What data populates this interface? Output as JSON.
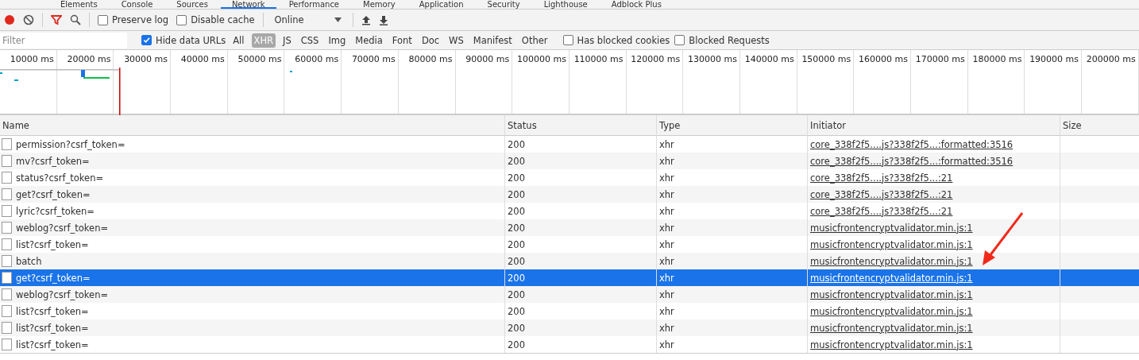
{
  "panel_tabs": [
    {
      "label": "Elements",
      "selected": false
    },
    {
      "label": "Console",
      "selected": false
    },
    {
      "label": "Sources",
      "selected": false
    },
    {
      "label": "Network",
      "selected": true
    },
    {
      "label": "Performance",
      "selected": false
    },
    {
      "label": "Memory",
      "selected": false
    },
    {
      "label": "Application",
      "selected": false
    },
    {
      "label": "Security",
      "selected": false
    },
    {
      "label": "Lighthouse",
      "selected": false
    },
    {
      "label": "Adblock Plus",
      "selected": false
    }
  ],
  "toolbar": {
    "recording": true,
    "filter_active": true,
    "preserve_log": {
      "label": "Preserve log",
      "checked": false
    },
    "disable_cache": {
      "label": "Disable cache",
      "checked": false
    },
    "throttling": "Online"
  },
  "filter_bar": {
    "placeholder": "Filter",
    "hide_data_urls": {
      "label": "Hide data URLs",
      "checked": true
    },
    "types": [
      {
        "label": "All",
        "selected": false
      },
      {
        "label": "XHR",
        "selected": true
      },
      {
        "label": "JS",
        "selected": false
      },
      {
        "label": "CSS",
        "selected": false
      },
      {
        "label": "Img",
        "selected": false
      },
      {
        "label": "Media",
        "selected": false
      },
      {
        "label": "Font",
        "selected": false
      },
      {
        "label": "Doc",
        "selected": false
      },
      {
        "label": "WS",
        "selected": false
      },
      {
        "label": "Manifest",
        "selected": false
      },
      {
        "label": "Other",
        "selected": false
      }
    ],
    "has_blocked_cookies": {
      "label": "Has blocked cookies",
      "checked": false
    },
    "blocked_requests": {
      "label": "Blocked Requests",
      "checked": false
    }
  },
  "overview": {
    "ticks": [
      "10000 ms",
      "20000 ms",
      "30000 ms",
      "40000 ms",
      "50000 ms",
      "60000 ms",
      "70000 ms",
      "80000 ms",
      "90000 ms",
      "100000 ms",
      "110000 ms",
      "120000 ms",
      "130000 ms",
      "140000 ms",
      "150000 ms",
      "160000 ms",
      "170000 ms",
      "180000 ms",
      "190000 ms",
      "200000 ms"
    ]
  },
  "table": {
    "columns": [
      "Name",
      "Status",
      "Type",
      "Initiator",
      "Size"
    ],
    "rows": [
      {
        "name": "permission?csrf_token=",
        "status": "200",
        "type": "xhr",
        "initiator": "core_338f2f5....js?338f2f5...:formatted:3516",
        "selected": false
      },
      {
        "name": "mv?csrf_token=",
        "status": "200",
        "type": "xhr",
        "initiator": "core_338f2f5....js?338f2f5...:formatted:3516",
        "selected": false
      },
      {
        "name": "status?csrf_token=",
        "status": "200",
        "type": "xhr",
        "initiator": "core_338f2f5....js?338f2f5...:21",
        "selected": false
      },
      {
        "name": "get?csrf_token=",
        "status": "200",
        "type": "xhr",
        "initiator": "core_338f2f5....js?338f2f5...:21",
        "selected": false
      },
      {
        "name": "lyric?csrf_token=",
        "status": "200",
        "type": "xhr",
        "initiator": "core_338f2f5....js?338f2f5...:21",
        "selected": false
      },
      {
        "name": "weblog?csrf_token=",
        "status": "200",
        "type": "xhr",
        "initiator": "musicfrontencryptvalidator.min.js:1",
        "selected": false
      },
      {
        "name": "list?csrf_token=",
        "status": "200",
        "type": "xhr",
        "initiator": "musicfrontencryptvalidator.min.js:1",
        "selected": false
      },
      {
        "name": "batch",
        "status": "200",
        "type": "xhr",
        "initiator": "musicfrontencryptvalidator.min.js:1",
        "selected": false
      },
      {
        "name": "get?csrf_token=",
        "status": "200",
        "type": "xhr",
        "initiator": "musicfrontencryptvalidator.min.js:1",
        "selected": true
      },
      {
        "name": "weblog?csrf_token=",
        "status": "200",
        "type": "xhr",
        "initiator": "musicfrontencryptvalidator.min.js:1",
        "selected": false
      },
      {
        "name": "list?csrf_token=",
        "status": "200",
        "type": "xhr",
        "initiator": "musicfrontencryptvalidator.min.js:1",
        "selected": false
      },
      {
        "name": "list?csrf_token=",
        "status": "200",
        "type": "xhr",
        "initiator": "musicfrontencryptvalidator.min.js:1",
        "selected": false
      },
      {
        "name": "list?csrf_token=",
        "status": "200",
        "type": "xhr",
        "initiator": "musicfrontencryptvalidator.min.js:1",
        "selected": false
      }
    ]
  }
}
